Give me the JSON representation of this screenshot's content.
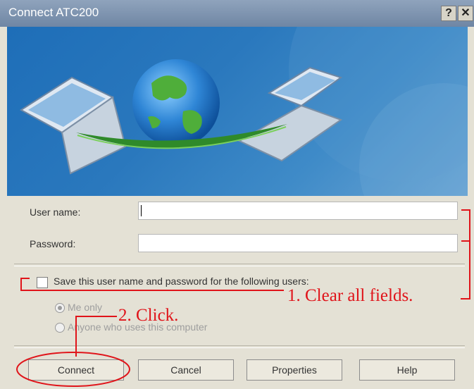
{
  "window": {
    "title": "Connect ATC200",
    "help_label": "?",
    "close_label": "✕"
  },
  "form": {
    "username_label": "User name:",
    "username_value": "",
    "password_label": "Password:",
    "password_value": "",
    "save_checkbox_label": "Save this user name and password for the following users:",
    "save_checked": false,
    "radio_me_only": "Me only",
    "radio_anyone": "Anyone who uses this computer",
    "selected_radio": "Me only"
  },
  "buttons": {
    "connect": "Connect",
    "cancel": "Cancel",
    "properties": "Properties",
    "help": "Help"
  },
  "annotations": {
    "step1": "1. Clear all fields.",
    "step2": "2. Click."
  },
  "colors": {
    "annotation": "#e0141a",
    "title_bar": "#7a90ad",
    "banner": "#2a78bd"
  }
}
